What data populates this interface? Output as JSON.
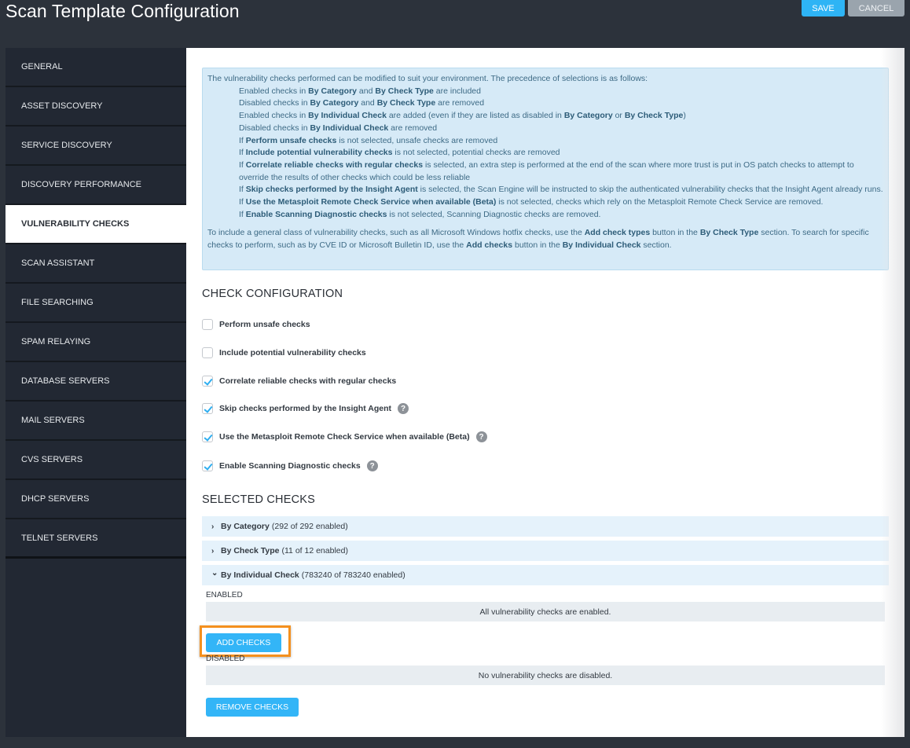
{
  "header": {
    "title": "Scan Template Configuration",
    "save_label": "SAVE",
    "cancel_label": "CANCEL"
  },
  "sidebar": {
    "items": [
      {
        "label": "GENERAL",
        "active": false
      },
      {
        "label": "ASSET DISCOVERY",
        "active": false
      },
      {
        "label": "SERVICE DISCOVERY",
        "active": false
      },
      {
        "label": "DISCOVERY PERFORMANCE",
        "active": false
      },
      {
        "label": "VULNERABILITY CHECKS",
        "active": true
      },
      {
        "label": "SCAN ASSISTANT",
        "active": false
      },
      {
        "label": "FILE SEARCHING",
        "active": false
      },
      {
        "label": "SPAM RELAYING",
        "active": false
      },
      {
        "label": "DATABASE SERVERS",
        "active": false
      },
      {
        "label": "MAIL SERVERS",
        "active": false
      },
      {
        "label": "CVS SERVERS",
        "active": false
      },
      {
        "label": "DHCP SERVERS",
        "active": false
      },
      {
        "label": "TELNET SERVERS",
        "active": false
      }
    ]
  },
  "info": {
    "intro": "The vulnerability checks performed can be modified to suit your environment. The precedence of selections is as follows:",
    "rules": [
      [
        [
          "t",
          "Enabled checks in "
        ],
        [
          "b",
          "By Category"
        ],
        [
          "t",
          " and "
        ],
        [
          "b",
          "By Check Type"
        ],
        [
          "t",
          " are included"
        ]
      ],
      [
        [
          "t",
          "Disabled checks in "
        ],
        [
          "b",
          "By Category"
        ],
        [
          "t",
          " and "
        ],
        [
          "b",
          "By Check Type"
        ],
        [
          "t",
          " are removed"
        ]
      ],
      [
        [
          "t",
          "Enabled checks in "
        ],
        [
          "b",
          "By Individual Check"
        ],
        [
          "t",
          " are added (even if they are listed as disabled in "
        ],
        [
          "b",
          "By Category"
        ],
        [
          "t",
          " or "
        ],
        [
          "b",
          "By Check Type"
        ],
        [
          "t",
          ")"
        ]
      ],
      [
        [
          "t",
          "Disabled checks in "
        ],
        [
          "b",
          "By Individual Check"
        ],
        [
          "t",
          " are removed"
        ]
      ],
      [
        [
          "t",
          "If "
        ],
        [
          "b",
          "Perform unsafe checks"
        ],
        [
          "t",
          " is not selected, unsafe checks are removed"
        ]
      ],
      [
        [
          "t",
          "If "
        ],
        [
          "b",
          "Include potential vulnerability checks"
        ],
        [
          "t",
          " is not selected, potential checks are removed"
        ]
      ],
      [
        [
          "t",
          "If "
        ],
        [
          "b",
          "Correlate reliable checks with regular checks"
        ],
        [
          "t",
          " is selected, an extra step is performed at the end of the scan where more trust is put in OS patch checks to attempt to override the results of other checks which could be less reliable"
        ]
      ],
      [
        [
          "t",
          "If "
        ],
        [
          "b",
          "Skip checks performed by the Insight Agent"
        ],
        [
          "t",
          " is selected, the Scan Engine will be instructed to skip the authenticated vulnerability checks that the Insight Agent already runs."
        ]
      ],
      [
        [
          "t",
          "If "
        ],
        [
          "b",
          "Use the Metasploit Remote Check Service when available (Beta)"
        ],
        [
          "t",
          " is not selected, checks which rely on the Metasploit Remote Check Service are removed."
        ]
      ],
      [
        [
          "t",
          "If "
        ],
        [
          "b",
          "Enable Scanning Diagnostic checks"
        ],
        [
          "t",
          " is not selected, Scanning Diagnostic checks are removed."
        ]
      ]
    ],
    "footer": [
      [
        "t",
        "To include a general class of vulnerability checks, such as all Microsoft Windows hotfix checks, use the "
      ],
      [
        "b",
        "Add check types"
      ],
      [
        "t",
        " button in the "
      ],
      [
        "b",
        "By Check Type"
      ],
      [
        "t",
        " section. To search for specific checks to perform, such as by CVE ID or Microsoft Bulletin ID, use the "
      ],
      [
        "b",
        "Add checks"
      ],
      [
        "t",
        " button in the "
      ],
      [
        "b",
        "By Individual Check"
      ],
      [
        "t",
        " section."
      ]
    ]
  },
  "check_config": {
    "title": "CHECK CONFIGURATION",
    "options": [
      {
        "label": "Perform unsafe checks",
        "checked": false,
        "help": false
      },
      {
        "label": "Include potential vulnerability checks",
        "checked": false,
        "help": false
      },
      {
        "label": "Correlate reliable checks with regular checks",
        "checked": true,
        "help": false
      },
      {
        "label": "Skip checks performed by the Insight Agent",
        "checked": true,
        "help": true
      },
      {
        "label": "Use the Metasploit Remote Check Service when available (Beta)",
        "checked": true,
        "help": true
      },
      {
        "label": "Enable Scanning Diagnostic checks",
        "checked": true,
        "help": true
      }
    ]
  },
  "selected_checks": {
    "title": "SELECTED CHECKS",
    "sections": [
      {
        "label": "By Category",
        "count": "(292 of 292 enabled)",
        "expanded": false,
        "chevron": "›"
      },
      {
        "label": "By Check Type",
        "count": "(11 of 12 enabled)",
        "expanded": false,
        "chevron": "›"
      },
      {
        "label": "By Individual Check",
        "count": "(783240 of 783240 enabled)",
        "expanded": true,
        "chevron": "⌄"
      }
    ],
    "enabled_label": "ENABLED",
    "enabled_empty": "All vulnerability checks are enabled.",
    "add_checks_label": "ADD CHECKS",
    "disabled_label": "DISABLED",
    "disabled_empty": "No vulnerability checks are disabled.",
    "remove_checks_label": "REMOVE CHECKS"
  },
  "colors": {
    "accent": "#33b5f7",
    "highlight": "#f4901e",
    "sidebar_bg": "#222833",
    "info_bg": "#d6eaf7"
  }
}
